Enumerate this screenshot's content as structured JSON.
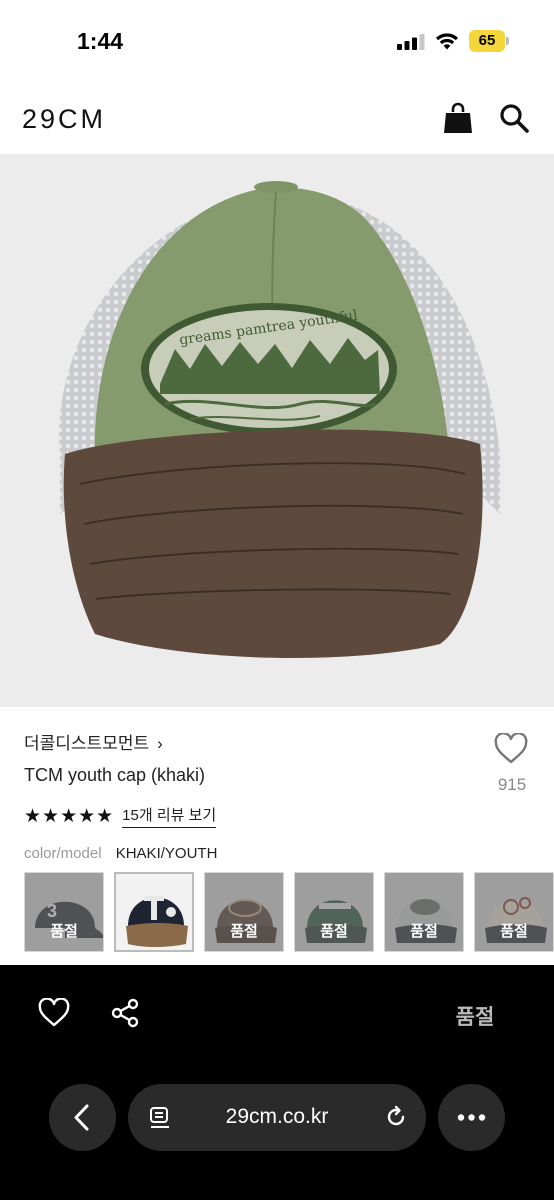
{
  "status_bar": {
    "time": "1:44",
    "battery": "65"
  },
  "header": {
    "logo": "29CM",
    "icons": [
      "bag-icon",
      "search-icon"
    ]
  },
  "product": {
    "brand": "더콜디스트모먼트",
    "brand_chevron": "›",
    "name": "TCM youth cap (khaki)",
    "likes": "915",
    "stars": "★★★★★",
    "review_link": "15개 리뷰 보기",
    "option_label": "color/model",
    "option_value": "KHAKI/YOUTH",
    "patch_text": "greams pamtrea youthful"
  },
  "thumbnails": [
    {
      "soldout": "품절",
      "selected": false
    },
    {
      "soldout": "",
      "selected": true
    },
    {
      "soldout": "품절",
      "selected": false
    },
    {
      "soldout": "품절",
      "selected": false
    },
    {
      "soldout": "품절",
      "selected": false
    },
    {
      "soldout": "품절",
      "selected": false
    }
  ],
  "bottom_bar": {
    "soldout": "품절",
    "url": "29cm.co.kr"
  },
  "colors": {
    "yellow_battery": "#f4d63a",
    "dark_pill": "#2a2a2a"
  }
}
